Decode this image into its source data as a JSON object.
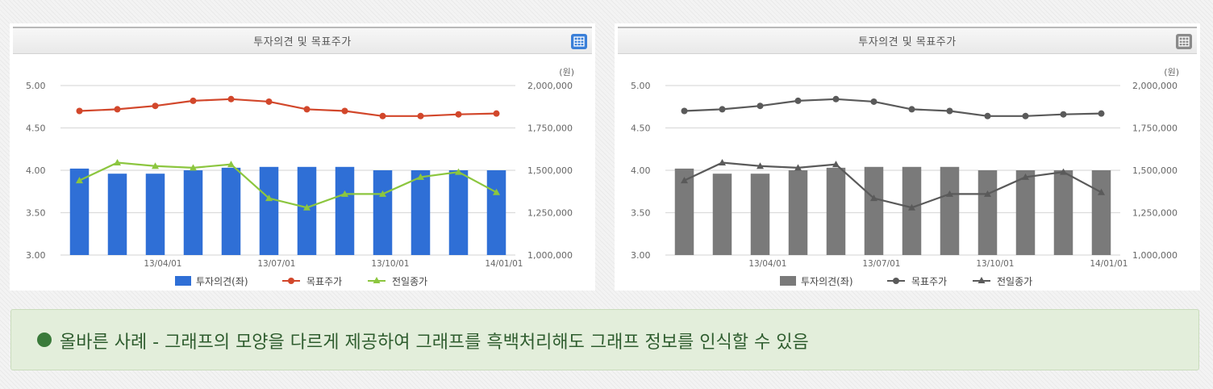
{
  "panels": [
    {
      "title": "투자의견 및 목표주가",
      "icon": "table-icon",
      "icon_color": "#3a7fd8",
      "colors": {
        "bar": "#2f6fd6",
        "target": "#d2472b",
        "close": "#8cc63f"
      },
      "legend": {
        "bar": "투자의견(좌)",
        "target": "목표주가",
        "close": "전일종가"
      }
    },
    {
      "title": "투자의견 및 목표주가",
      "icon": "table-icon",
      "icon_color": "#8a8a8a",
      "colors": {
        "bar": "#7a7a7a",
        "target": "#5a5a5a",
        "close": "#5a5a5a"
      },
      "legend": {
        "bar": "투자의견(좌)",
        "target": "목표주가",
        "close": "전일종가"
      }
    }
  ],
  "chart_data": [
    {
      "type": "bar",
      "unit_label": "(원)",
      "y_left": {
        "ticks": [
          "5.00",
          "4.50",
          "4.00",
          "3.50",
          "3.00"
        ],
        "lim": [
          3.0,
          5.0
        ]
      },
      "y_right": {
        "ticks": [
          "2,000,000",
          "1,750,000",
          "1,500,000",
          "1,250,000",
          "1,000,000"
        ],
        "lim": [
          1000000,
          2000000
        ]
      },
      "x_ticks": [
        "13/04/01",
        "13/07/01",
        "13/10/01",
        "14/01/01"
      ],
      "series": [
        {
          "name": "투자의견(좌)",
          "type": "bar",
          "axis": "left",
          "values": [
            4.02,
            3.96,
            3.96,
            4.0,
            4.03,
            4.04,
            4.04,
            4.04,
            4.0,
            4.0,
            4.0,
            4.0
          ]
        },
        {
          "name": "목표주가",
          "type": "line",
          "marker": "circle",
          "axis": "right",
          "values": [
            1850000,
            1860000,
            1880000,
            1910000,
            1920000,
            1905000,
            1860000,
            1850000,
            1820000,
            1820000,
            1830000,
            1835000
          ]
        },
        {
          "name": "전일종가",
          "type": "line",
          "marker": "triangle",
          "axis": "right",
          "values": [
            1440000,
            1545000,
            1525000,
            1515000,
            1535000,
            1335000,
            1280000,
            1360000,
            1360000,
            1460000,
            1490000,
            1370000
          ]
        }
      ],
      "grid": true,
      "legend_position": "bottom"
    },
    {
      "type": "bar",
      "unit_label": "(원)",
      "y_left": {
        "ticks": [
          "5.00",
          "4.50",
          "4.00",
          "3.50",
          "3.00"
        ],
        "lim": [
          3.0,
          5.0
        ]
      },
      "y_right": {
        "ticks": [
          "2,000,000",
          "1,750,000",
          "1,500,000",
          "1,250,000",
          "1,000,000"
        ],
        "lim": [
          1000000,
          2000000
        ]
      },
      "x_ticks": [
        "13/04/01",
        "13/07/01",
        "13/10/01",
        "14/01/01"
      ],
      "series": [
        {
          "name": "투자의견(좌)",
          "type": "bar",
          "axis": "left",
          "values": [
            4.02,
            3.96,
            3.96,
            4.0,
            4.03,
            4.04,
            4.04,
            4.04,
            4.0,
            4.0,
            4.0,
            4.0
          ]
        },
        {
          "name": "목표주가",
          "type": "line",
          "marker": "circle",
          "axis": "right",
          "values": [
            1850000,
            1860000,
            1880000,
            1910000,
            1920000,
            1905000,
            1860000,
            1850000,
            1820000,
            1820000,
            1830000,
            1835000
          ]
        },
        {
          "name": "전일종가",
          "type": "line",
          "marker": "triangle",
          "axis": "right",
          "values": [
            1440000,
            1545000,
            1525000,
            1515000,
            1535000,
            1335000,
            1280000,
            1360000,
            1360000,
            1460000,
            1490000,
            1370000
          ]
        }
      ],
      "grid": true,
      "legend_position": "bottom"
    }
  ],
  "note": {
    "text": "올바른 사례 - 그래프의 모양을 다르게 제공하여 그래프를 흑백처리해도 그래프 정보를 인식할 수 있음",
    "color": "#3a7a3a"
  }
}
